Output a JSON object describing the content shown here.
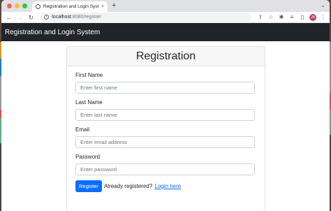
{
  "browser": {
    "tab_title": "Registration and Login System",
    "tab_close": "×",
    "new_tab": "+",
    "url_host": "localhost",
    "url_path": ":8080/register",
    "profile_initials": "JA",
    "icons": [
      "back-icon",
      "forward-icon",
      "reload-icon",
      "info-icon",
      "share-icon",
      "bookmark-star-icon",
      "extensions-icon",
      "reading-list-icon",
      "sidebar-icon",
      "menu-icon"
    ]
  },
  "navbar": {
    "brand": "Registration and Login System"
  },
  "form": {
    "heading": "Registration",
    "first_name": {
      "label": "First Name",
      "placeholder": "Enter first name",
      "value": ""
    },
    "last_name": {
      "label": "Last Name",
      "placeholder": "Enter last name",
      "value": ""
    },
    "email": {
      "label": "Email",
      "placeholder": "Enter email address",
      "value": ""
    },
    "password": {
      "label": "Password",
      "placeholder": "Enter password",
      "value": ""
    },
    "submit_label": "Register",
    "already_text": "Already registered?",
    "login_link": "Login here"
  },
  "colors": {
    "navbar_bg": "#212529",
    "primary": "#0d6efd"
  }
}
